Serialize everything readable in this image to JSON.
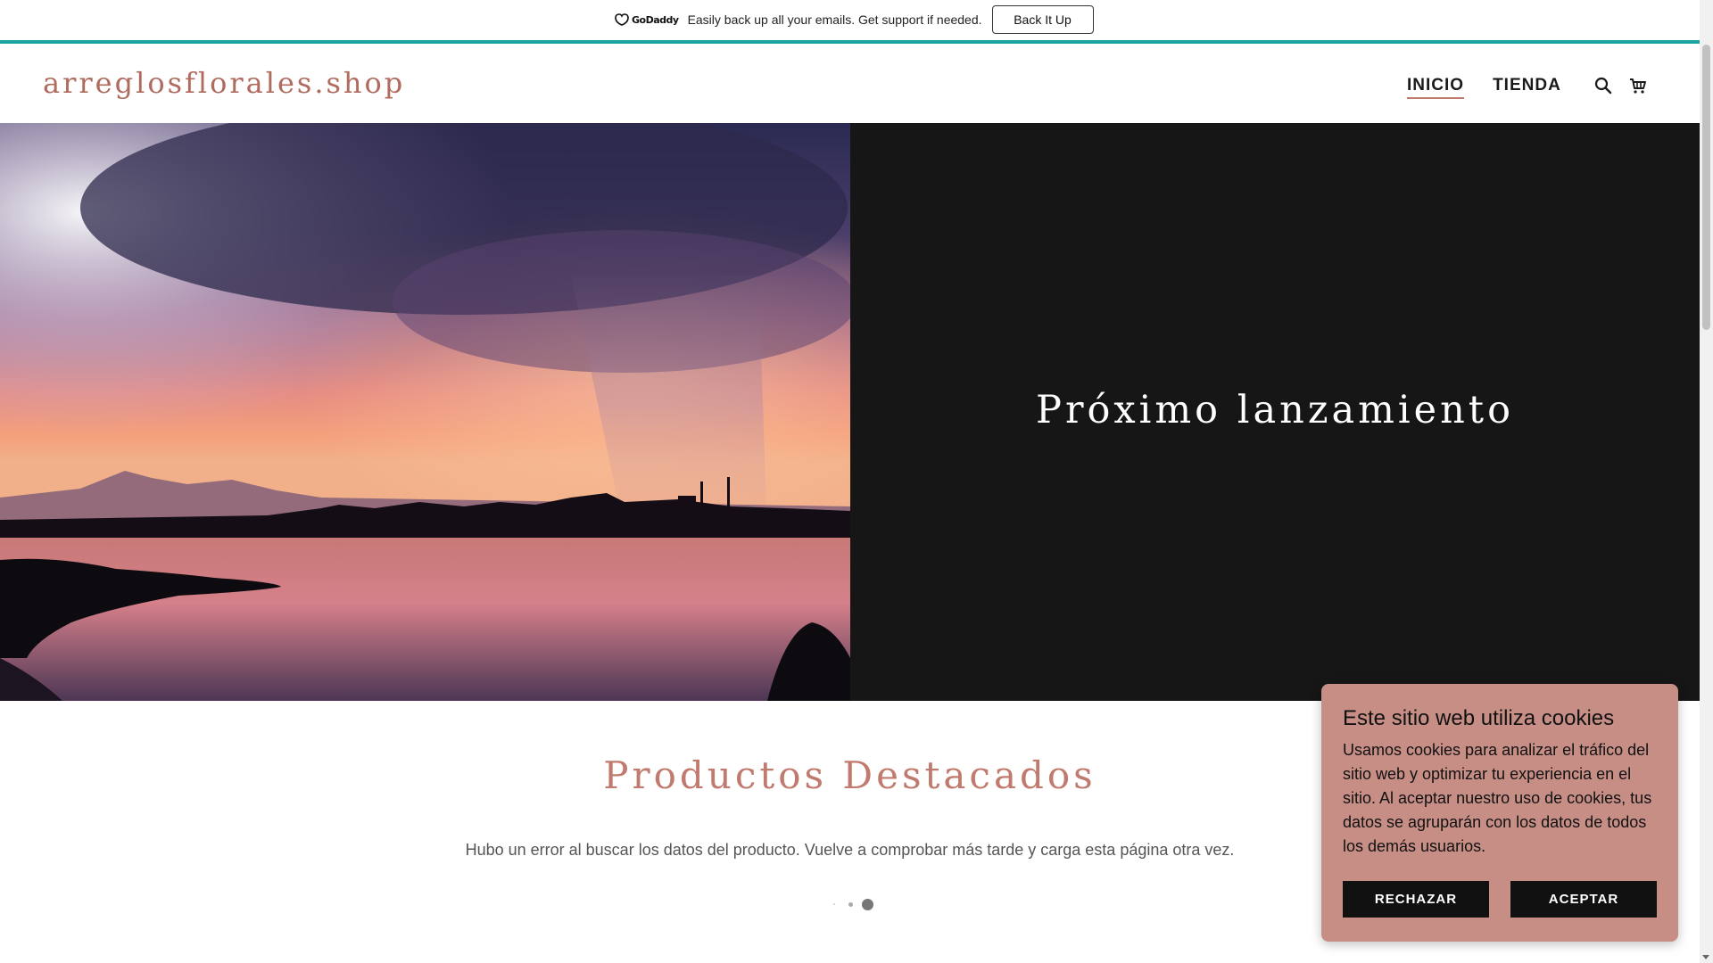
{
  "promo": {
    "brand": "GoDaddy",
    "message": "Easily back up all your emails. Get support if needed.",
    "button_label": "Back It Up",
    "accent_color": "#1aa3a3"
  },
  "header": {
    "site_title": "arreglosflorales.shop",
    "nav": [
      {
        "label": "INICIO",
        "active": true
      },
      {
        "label": "TIENDA",
        "active": false
      }
    ],
    "icons": [
      "search-icon",
      "cart-icon"
    ]
  },
  "hero": {
    "title": "Próximo lanzamiento"
  },
  "products": {
    "section_title": "Productos Destacados",
    "error_message": "Hubo un error al buscar los datos del producto. Vuelve a comprobar más tarde y carga esta página otra vez."
  },
  "cookie_banner": {
    "title": "Este sitio web utiliza cookies",
    "body": "Usamos cookies para analizar el tráfico del sitio web y optimizar tu experiencia en el sitio. Al aceptar nuestro uso de cookies, tus datos se agruparán con los datos de todos los demás usuarios.",
    "reject_label": "RECHAZAR",
    "accept_label": "ACEPTAR"
  },
  "colors": {
    "brand_rose": "#c17a6e",
    "hero_dark": "#161616",
    "cookie_bg": "#c78e86"
  }
}
